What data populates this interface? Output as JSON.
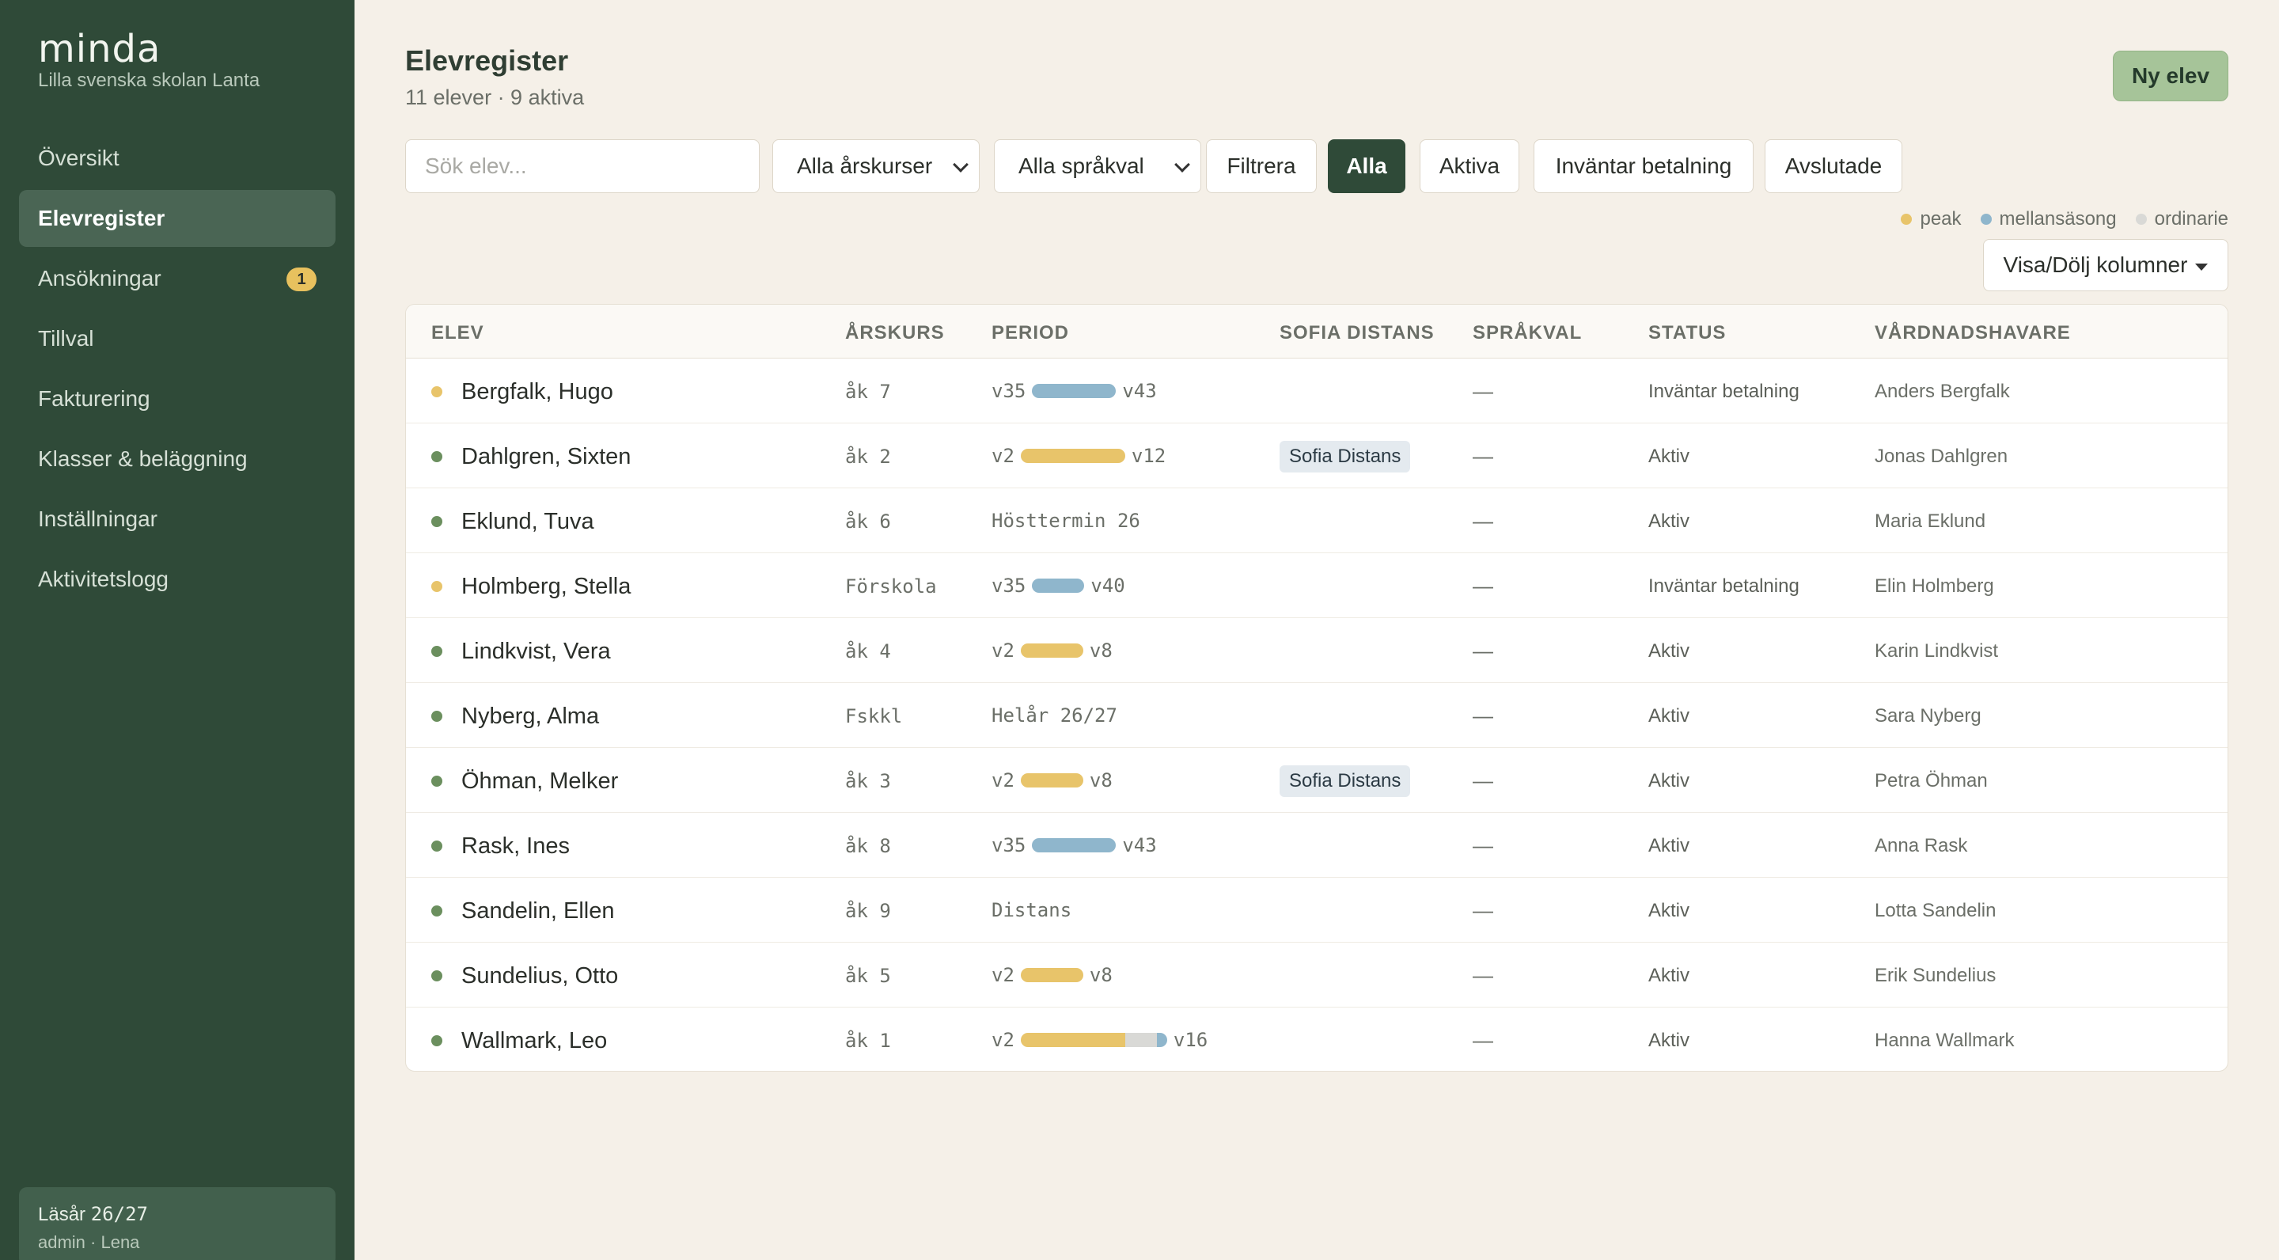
{
  "brand": {
    "logo": "minda",
    "school": "Lilla svenska skolan Lanta"
  },
  "sidebar": {
    "items": [
      {
        "label": "Översikt",
        "active": false,
        "badge": ""
      },
      {
        "label": "Elevregister",
        "active": true,
        "badge": ""
      },
      {
        "label": "Ansökningar",
        "active": false,
        "badge": "1"
      },
      {
        "label": "Tillval",
        "active": false,
        "badge": ""
      },
      {
        "label": "Fakturering",
        "active": false,
        "badge": ""
      },
      {
        "label": "Klasser & beläggning",
        "active": false,
        "badge": ""
      },
      {
        "label": "Inställningar",
        "active": false,
        "badge": ""
      },
      {
        "label": "Aktivitetslogg",
        "active": false,
        "badge": ""
      }
    ],
    "year_label": "Läsår",
    "year_value": "26/27",
    "user": "admin · Lena"
  },
  "header": {
    "title": "Elevregister",
    "subtitle": "11 elever · 9 aktiva",
    "new_button": "Ny elev"
  },
  "filters": {
    "search_placeholder": "Sök elev...",
    "grade_select": "Alla årskurser",
    "language_select": "Alla språkval",
    "filter_button": "Filtrera",
    "pills": [
      {
        "label": "Alla",
        "active": true
      },
      {
        "label": "Aktiva",
        "active": false
      },
      {
        "label": "Inväntar betalning",
        "active": false
      },
      {
        "label": "Avslutade",
        "active": false
      }
    ]
  },
  "legend": {
    "items": [
      {
        "label": "peak",
        "color": "#e8c46a"
      },
      {
        "label": "mellansäsong",
        "color": "#8fb6cc"
      },
      {
        "label": "ordinarie",
        "color": "#d9d9d6"
      }
    ]
  },
  "columns_button": "Visa/Dölj kolumner",
  "colors": {
    "peak": "#e8c46a",
    "mid": "#8fb6cc",
    "ordinary": "#d9d9d6",
    "status_active": "#6b8f5e",
    "status_pending": "#e8c46a"
  },
  "table": {
    "headers": {
      "student": "ELEV",
      "grade": "ÅRSKURS",
      "period": "PERIOD",
      "distance": "SOFIA DISTANS",
      "language": "SPRÅKVAL",
      "status": "STATUS",
      "guardian": "VÅRDNADSHAVARE"
    },
    "rows": [
      {
        "name": "Bergfalk, Hugo",
        "grade": "åk 7",
        "period_type": "bar",
        "period_start": "v35",
        "period_end": "v43",
        "bar": [
          {
            "kind": "mid",
            "weeks": 8
          }
        ],
        "distance": "",
        "language": "—",
        "status": "Inväntar betalning",
        "status_kind": "pending",
        "guardian": "Anders Bergfalk"
      },
      {
        "name": "Dahlgren, Sixten",
        "grade": "åk 2",
        "period_type": "bar",
        "period_start": "v2",
        "period_end": "v12",
        "bar": [
          {
            "kind": "peak",
            "weeks": 10
          }
        ],
        "distance": "Sofia Distans",
        "language": "—",
        "status": "Aktiv",
        "status_kind": "active",
        "guardian": "Jonas Dahlgren"
      },
      {
        "name": "Eklund, Tuva",
        "grade": "åk 6",
        "period_type": "text",
        "period_text": "Hösttermin 26",
        "distance": "",
        "language": "—",
        "status": "Aktiv",
        "status_kind": "active",
        "guardian": "Maria Eklund"
      },
      {
        "name": "Holmberg, Stella",
        "grade": "Förskola",
        "period_type": "bar",
        "period_start": "v35",
        "period_end": "v40",
        "bar": [
          {
            "kind": "mid",
            "weeks": 5
          }
        ],
        "distance": "",
        "language": "—",
        "status": "Inväntar betalning",
        "status_kind": "pending",
        "guardian": "Elin Holmberg"
      },
      {
        "name": "Lindkvist, Vera",
        "grade": "åk 4",
        "period_type": "bar",
        "period_start": "v2",
        "period_end": "v8",
        "bar": [
          {
            "kind": "peak",
            "weeks": 6
          }
        ],
        "distance": "",
        "language": "—",
        "status": "Aktiv",
        "status_kind": "active",
        "guardian": "Karin Lindkvist"
      },
      {
        "name": "Nyberg, Alma",
        "grade": "Fskkl",
        "period_type": "text",
        "period_text": "Helår 26/27",
        "distance": "",
        "language": "—",
        "status": "Aktiv",
        "status_kind": "active",
        "guardian": "Sara Nyberg"
      },
      {
        "name": "Öhman, Melker",
        "grade": "åk 3",
        "period_type": "bar",
        "period_start": "v2",
        "period_end": "v8",
        "bar": [
          {
            "kind": "peak",
            "weeks": 6
          }
        ],
        "distance": "Sofia Distans",
        "language": "—",
        "status": "Aktiv",
        "status_kind": "active",
        "guardian": "Petra Öhman"
      },
      {
        "name": "Rask, Ines",
        "grade": "åk 8",
        "period_type": "bar",
        "period_start": "v35",
        "period_end": "v43",
        "bar": [
          {
            "kind": "mid",
            "weeks": 8
          }
        ],
        "distance": "",
        "language": "—",
        "status": "Aktiv",
        "status_kind": "active",
        "guardian": "Anna Rask"
      },
      {
        "name": "Sandelin, Ellen",
        "grade": "åk 9",
        "period_type": "text",
        "period_text": "Distans",
        "distance": "",
        "language": "—",
        "status": "Aktiv",
        "status_kind": "active",
        "guardian": "Lotta Sandelin"
      },
      {
        "name": "Sundelius, Otto",
        "grade": "åk 5",
        "period_type": "bar",
        "period_start": "v2",
        "period_end": "v8",
        "bar": [
          {
            "kind": "peak",
            "weeks": 6
          }
        ],
        "distance": "",
        "language": "—",
        "status": "Aktiv",
        "status_kind": "active",
        "guardian": "Erik Sundelius"
      },
      {
        "name": "Wallmark, Leo",
        "grade": "åk 1",
        "period_type": "bar",
        "period_start": "v2",
        "period_end": "v16",
        "bar": [
          {
            "kind": "peak",
            "weeks": 10
          },
          {
            "kind": "ordinary",
            "weeks": 3
          },
          {
            "kind": "mid",
            "weeks": 1
          }
        ],
        "distance": "",
        "language": "—",
        "status": "Aktiv",
        "status_kind": "active",
        "guardian": "Hanna Wallmark"
      }
    ]
  }
}
